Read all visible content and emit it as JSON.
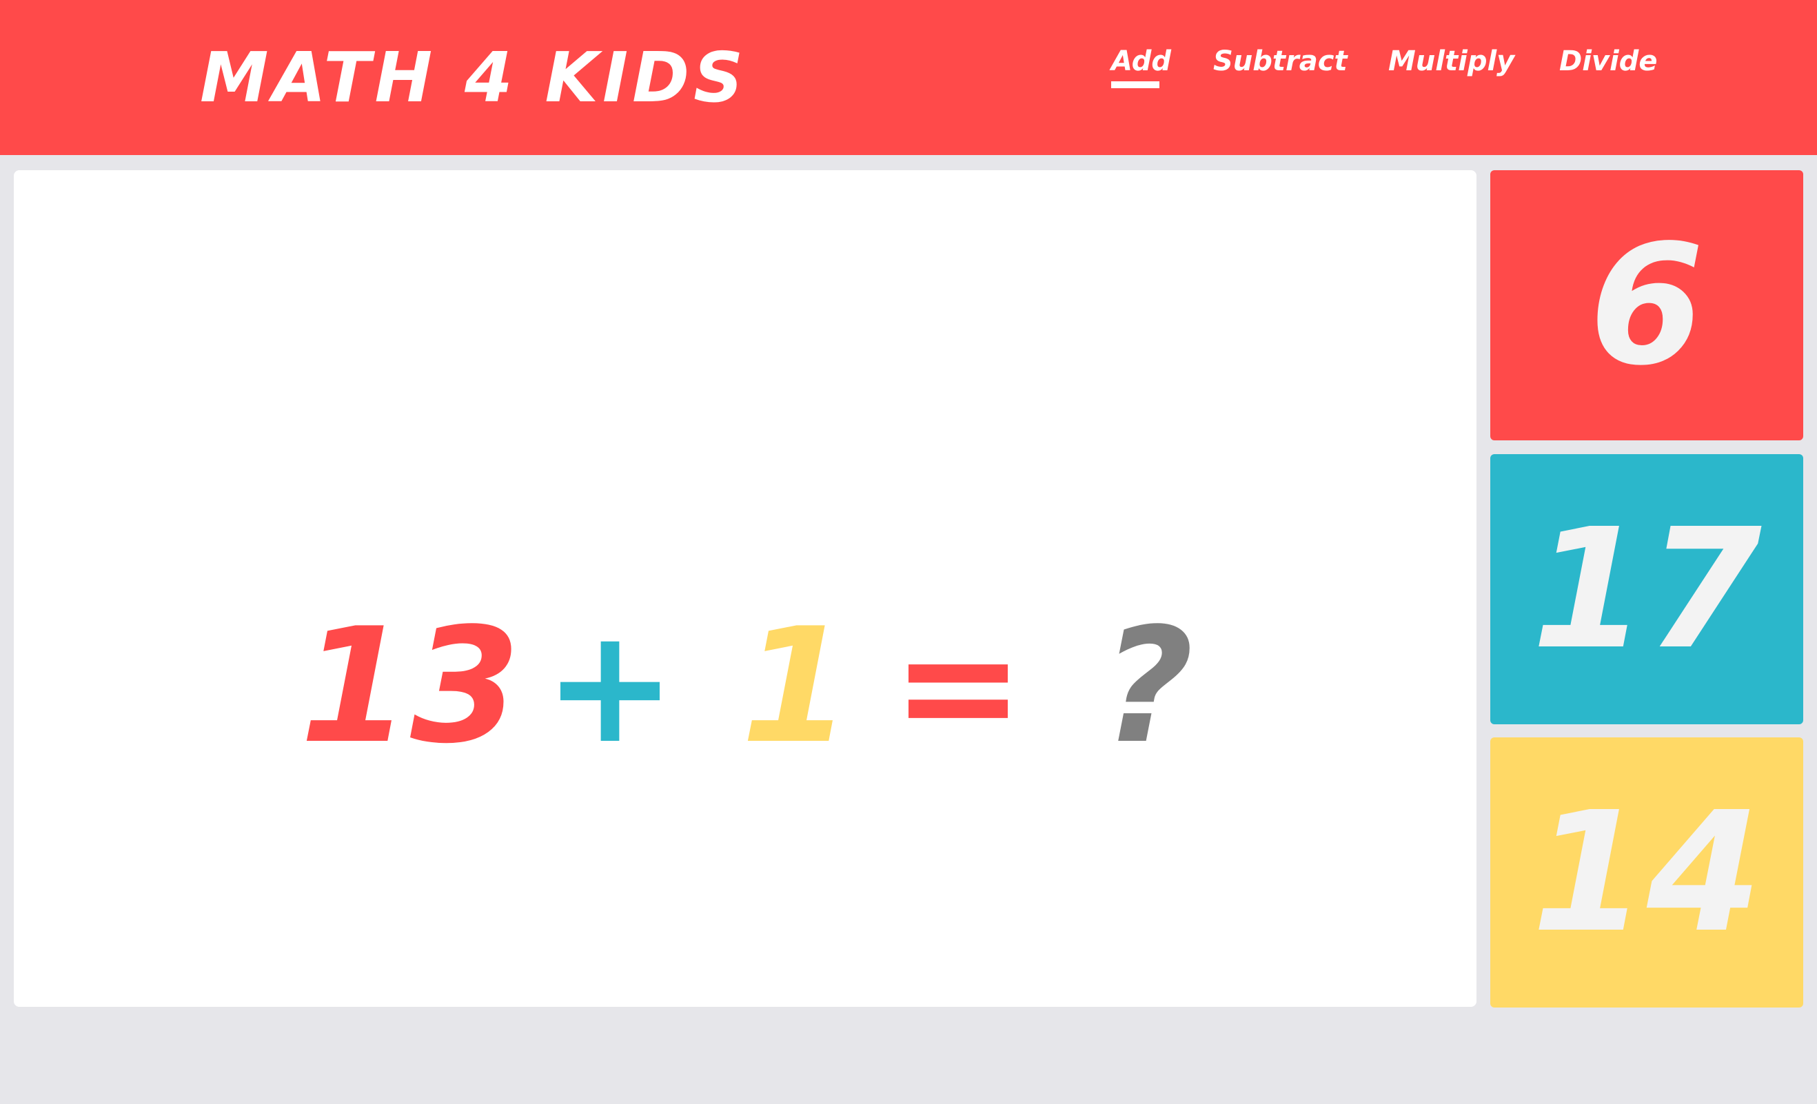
{
  "header": {
    "logo": "Math 4 Kids",
    "nav": [
      {
        "label": "Add",
        "active": true
      },
      {
        "label": "Subtract",
        "active": false
      },
      {
        "label": "Multiply",
        "active": false
      },
      {
        "label": "Divide",
        "active": false
      }
    ]
  },
  "question": {
    "operand_a": "13",
    "operator": "+",
    "operand_b": "1",
    "equals": "=",
    "unknown": "?"
  },
  "answers": [
    {
      "label": "6"
    },
    {
      "label": "17"
    },
    {
      "label": "14"
    }
  ],
  "colors": {
    "header_bg": "#ff4a4a",
    "page_bg": "#e6e6ea",
    "red": "#ff4a4a",
    "teal": "#2bb7cb",
    "yellow": "#ffd966",
    "gray": "#808080",
    "answer_text": "#f3f3f3"
  }
}
